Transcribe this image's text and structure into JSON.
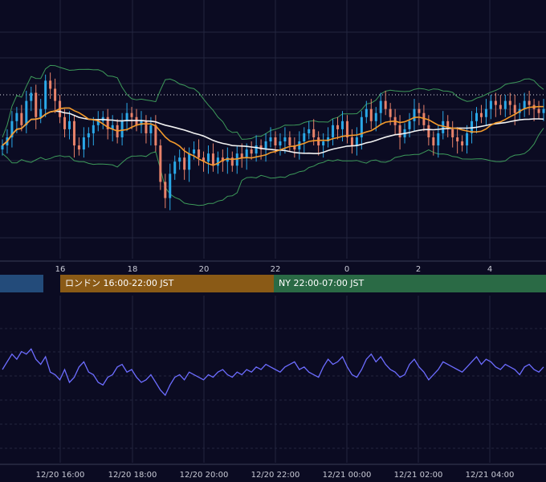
{
  "colors": {
    "background": "#0b0b22",
    "grid": "#23263f",
    "candle_up": "#2aa8e8",
    "candle_down": "#e8826a",
    "bollinger": "#3d9a5a",
    "ma_fast": "#f39a2b",
    "ma_slow": "#f2f2f2",
    "oscillator": "#6c6cff",
    "session_tokyo": "#234b7a",
    "session_london": "#8a5a16",
    "session_ny": "#2a6a45"
  },
  "sessions": {
    "tokyo": {
      "label": "",
      "color": "#234b7a"
    },
    "london": {
      "label": "ロンドン 16:00-22:00 JST",
      "color": "#8a5a16"
    },
    "ny": {
      "label": "NY 22:00-07:00 JST",
      "color": "#2a6a45"
    }
  },
  "chart_data": [
    {
      "type": "candlestick",
      "title": "",
      "x_ticks": [
        "16",
        "18",
        "20",
        "22",
        "0",
        "2",
        "4"
      ],
      "y_range": [
        0,
        100
      ],
      "reference_level": 73,
      "grid": true,
      "series": [
        {
          "type": "candlestick",
          "values_close": [
            48,
            52,
            60,
            64,
            58,
            70,
            74,
            62,
            66,
            80,
            76,
            70,
            62,
            56,
            60,
            48,
            46,
            52,
            54,
            58,
            60,
            62,
            56,
            58,
            52,
            60,
            64,
            62,
            58,
            60,
            54,
            58,
            48,
            30,
            22,
            34,
            40,
            42,
            36,
            44,
            46,
            42,
            40,
            44,
            38,
            42,
            40,
            42,
            38,
            44,
            42,
            46,
            44,
            48,
            46,
            50,
            52,
            48,
            50,
            52,
            48,
            46,
            50,
            54,
            56,
            52,
            48,
            50,
            52,
            58,
            56,
            60,
            52,
            48,
            52,
            62,
            66,
            60,
            64,
            70,
            66,
            62,
            58,
            52,
            56,
            60,
            66,
            64,
            58,
            52,
            48,
            54,
            60,
            56,
            52,
            50,
            48,
            54,
            60,
            64,
            62,
            66,
            70,
            68,
            66,
            70,
            68,
            64,
            66,
            70,
            68,
            66,
            64,
            66
          ]
        }
      ]
    },
    {
      "type": "line",
      "title": "",
      "x_ticks": [
        "12/20 16:00",
        "12/20 18:00",
        "12/20 20:00",
        "12/20 22:00",
        "12/21 00:00",
        "12/21 02:00",
        "12/21 04:00"
      ],
      "y_range": [
        0,
        100
      ],
      "grid": true,
      "series": [
        {
          "values": [
            50,
            56,
            62,
            58,
            64,
            62,
            66,
            58,
            54,
            60,
            48,
            46,
            42,
            50,
            40,
            44,
            52,
            56,
            48,
            46,
            40,
            38,
            44,
            46,
            52,
            54,
            48,
            50,
            44,
            40,
            42,
            46,
            40,
            34,
            30,
            38,
            44,
            46,
            42,
            48,
            46,
            44,
            42,
            46,
            44,
            48,
            50,
            46,
            44,
            48,
            46,
            50,
            48,
            52,
            50,
            54,
            52,
            50,
            48,
            52,
            54,
            56,
            50,
            52,
            48,
            46,
            44,
            52,
            58,
            54,
            56,
            60,
            52,
            46,
            44,
            50,
            58,
            62,
            56,
            60,
            54,
            50,
            48,
            44,
            46,
            54,
            58,
            52,
            48,
            42,
            46,
            50,
            56,
            54,
            52,
            50,
            48,
            52,
            56,
            60,
            54,
            58,
            56,
            52,
            50,
            54,
            52,
            50,
            46,
            52,
            54,
            50,
            48,
            52
          ]
        }
      ]
    }
  ]
}
